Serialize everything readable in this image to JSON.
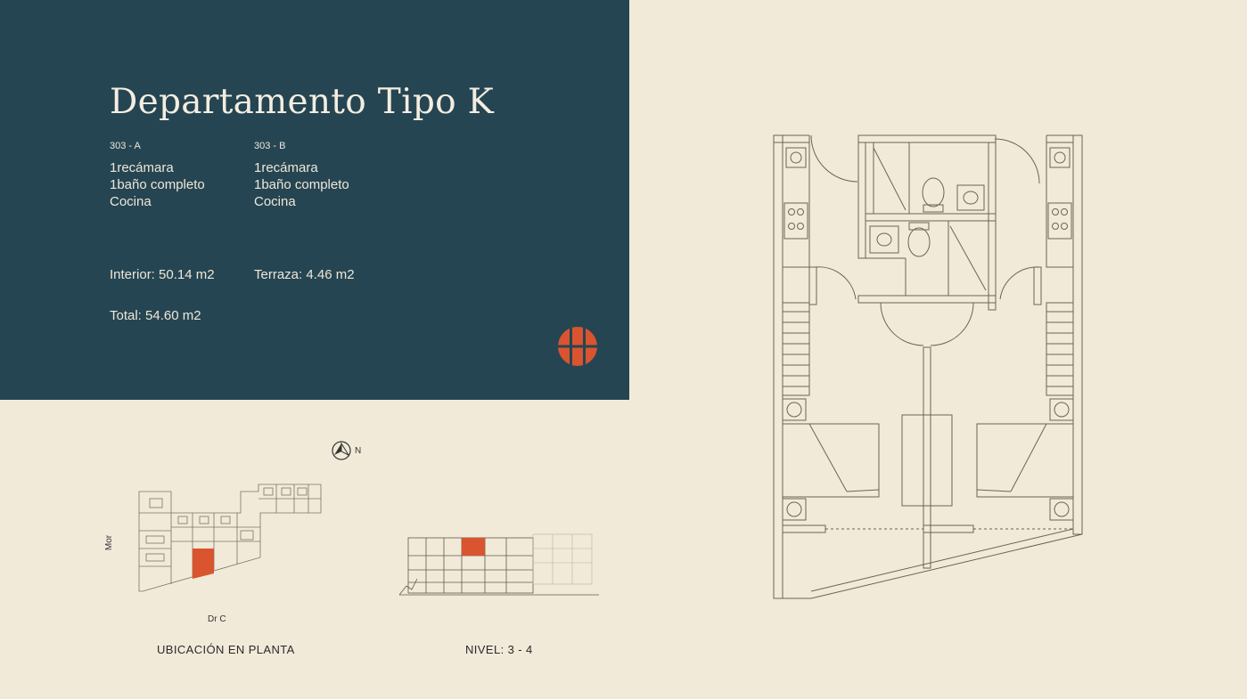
{
  "header": {
    "title": "Departamento Tipo K"
  },
  "units": [
    {
      "code": "303 - A",
      "features": [
        "1recámara",
        "1baño completo",
        "Cocina"
      ]
    },
    {
      "code": "303 - B",
      "features": [
        "1recámara",
        "1baño completo",
        "Cocina"
      ]
    }
  ],
  "areas": {
    "interior": "Interior: 50.14 m2",
    "terraza": "Terraza: 4.46 m2",
    "total": "Total: 54.60 m2"
  },
  "location": {
    "compass_label": "N",
    "street_side": "Mor",
    "street_bottom": "Dr C",
    "plan_caption": "UBICACIÓN EN PLANTA",
    "level_caption": "NIVEL: 3 - 4"
  },
  "colors": {
    "panel": "#254553",
    "background": "#f2ead9",
    "accent": "#d9542f",
    "line": "#6b6455"
  },
  "icons": {
    "logo": "brand-logo-icon",
    "compass": "north-compass-icon"
  }
}
